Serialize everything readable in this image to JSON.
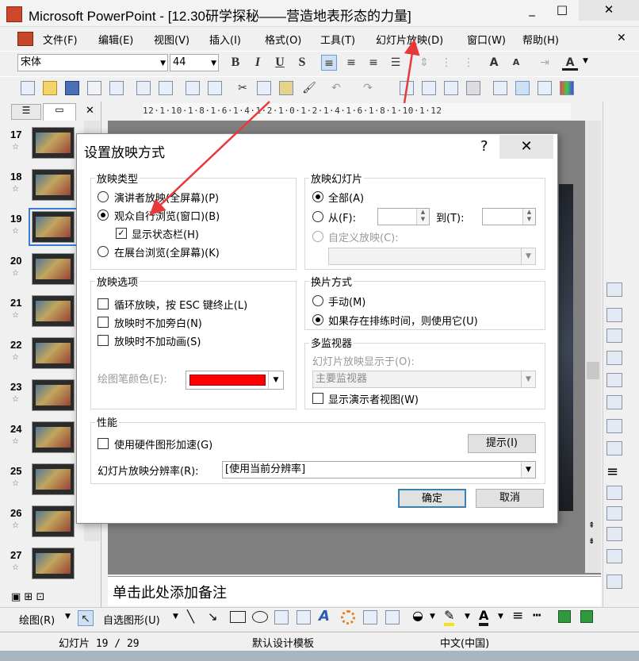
{
  "window": {
    "title": "Microsoft PowerPoint - [12.30研学探秘——营造地表形态的力量]",
    "min_glyph": "_",
    "max_glyph": "□",
    "close_glyph": "✕"
  },
  "menu": {
    "items": [
      "文件(F)",
      "编辑(E)",
      "视图(V)",
      "插入(I)",
      "格式(O)",
      "工具(T)",
      "幻灯片放映(D)",
      "窗口(W)",
      "帮助(H)"
    ],
    "close_glyph": "✕"
  },
  "format_toolbar": {
    "font": "宋体",
    "size": "44",
    "bold": "B",
    "italic": "I",
    "underline": "U",
    "shadow": "S"
  },
  "left_panel": {
    "tab_close": "✕",
    "slides": [
      {
        "num": "17"
      },
      {
        "num": "18"
      },
      {
        "num": "19"
      },
      {
        "num": "20"
      },
      {
        "num": "21"
      },
      {
        "num": "22"
      },
      {
        "num": "23"
      },
      {
        "num": "24"
      },
      {
        "num": "25"
      },
      {
        "num": "26"
      },
      {
        "num": "27"
      }
    ],
    "selected": "19"
  },
  "ruler": {
    "text": "12·1·10·1·8·1·6·1·4·1·2·1·0·1·2·1·4·1·6·1·8·1·10·1·12"
  },
  "notes": {
    "placeholder": "单击此处添加备注"
  },
  "dialog": {
    "title": "设置放映方式",
    "help": "?",
    "close": "✕",
    "show_type": {
      "label": "放映类型",
      "options": [
        "演讲者放映(全屏幕)(P)",
        "观众自行浏览(窗口)(B)",
        "在展台浏览(全屏幕)(K)"
      ],
      "selected": 1,
      "status_bar_label": "显示状态栏(H)",
      "status_bar_checked": true
    },
    "slides": {
      "label": "放映幻灯片",
      "all": "全部(A)",
      "from": "从(F):",
      "to": "到(T):",
      "custom": "自定义放映(C):",
      "selected": "all"
    },
    "options": {
      "label": "放映选项",
      "loop": "循环放映，按 ESC 键终止(L)",
      "no_narration": "放映时不加旁白(N)",
      "no_animation": "放映时不加动画(S)",
      "pen_color_label": "绘图笔颜色(E):",
      "pen_color": "#ff0000"
    },
    "advance": {
      "label": "换片方式",
      "manual": "手动(M)",
      "timings": "如果存在排练时间，则使用它(U)",
      "selected": "timings"
    },
    "monitors": {
      "label": "多监视器",
      "show_on": "幻灯片放映显示于(O):",
      "monitor": "主要监视器",
      "presenter_view": "显示演示者视图(W)"
    },
    "performance": {
      "label": "性能",
      "hw_accel": "使用硬件图形加速(G)",
      "tips": "提示(I)",
      "resolution_label": "幻灯片放映分辨率(R):",
      "resolution": "[使用当前分辨率]"
    },
    "ok": "确定",
    "cancel": "取消"
  },
  "draw_toolbar": {
    "draw": "绘图(R)",
    "autoshapes": "自选图形(U)"
  },
  "status": {
    "slide": "幻灯片 19 / 29",
    "template": "默认设计模板",
    "language": "中文(中国)"
  },
  "annotation_color": "#e8393a"
}
